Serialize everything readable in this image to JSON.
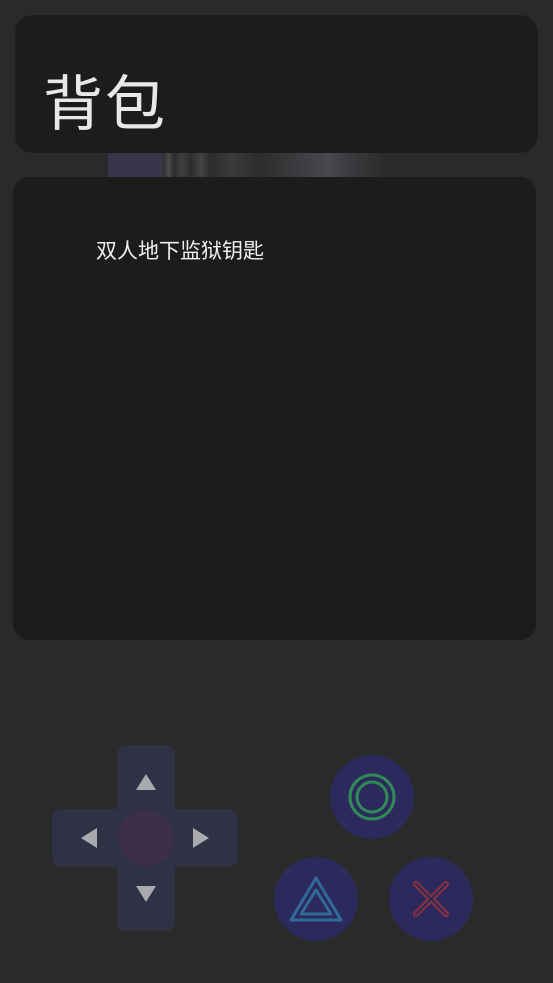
{
  "header": {
    "title": "背包"
  },
  "inventory": {
    "items": [
      {
        "label": "双人地下监狱钥匙"
      }
    ]
  },
  "controls": {
    "dpad": {
      "up_icon": "triangle-up-icon",
      "down_icon": "triangle-down-icon",
      "left_icon": "triangle-left-icon",
      "right_icon": "triangle-right-icon"
    },
    "buttons": {
      "circle_icon": "circle-icon",
      "triangle_icon": "triangle-icon",
      "cross_icon": "cross-icon"
    }
  },
  "colors": {
    "background": "#2a2a2b",
    "panel": "#1c1c1d",
    "dpad": "#2f3145",
    "action_button": "#2c2a5c",
    "circle_symbol": "#2f8a55",
    "triangle_symbol": "#2f6a9a",
    "cross_symbol": "#8a3040"
  }
}
